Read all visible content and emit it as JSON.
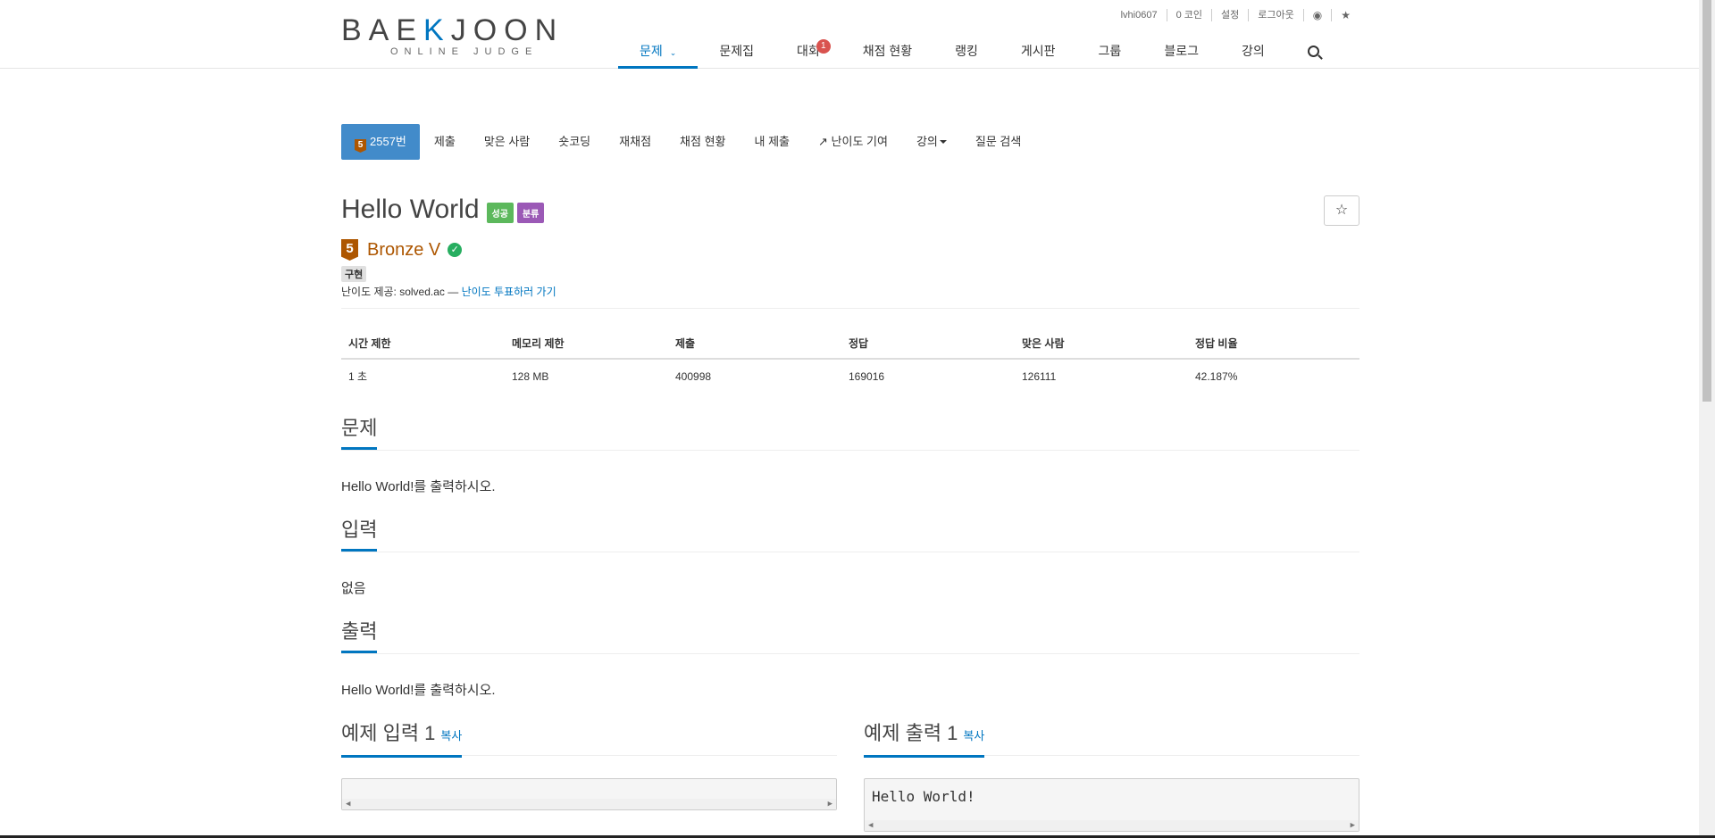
{
  "logo": {
    "main_a": "BAE",
    "main_accent": "K",
    "main_b": "JOON",
    "sub": "ONLINE JUDGE"
  },
  "topbar": {
    "user": "lvhi0607",
    "coins": "0 코인",
    "settings": "설정",
    "logout": "로그아웃"
  },
  "nav": {
    "problems": "문제",
    "workbook": "문제집",
    "contest": "대회",
    "contest_badge": "1",
    "status": "채점 현황",
    "ranking": "랭킹",
    "board": "게시판",
    "group": "그룹",
    "blog": "블로그",
    "lecture": "강의"
  },
  "pmenu": {
    "number": "2557번",
    "tier_digit": "5",
    "submit": "제출",
    "solved_users": "맞은 사람",
    "shortcoding": "숏코딩",
    "rejudge": "재채점",
    "status": "채점 현황",
    "my_submissions": "내 제출",
    "difficulty_contrib": "난이도 기여",
    "lecture": "강의",
    "question_search": "질문 검색"
  },
  "problem": {
    "title": "Hello World",
    "label_success": "성공",
    "label_category": "분류",
    "tier_digit": "5",
    "tier_name": "Bronze V",
    "tag": "구현",
    "credit_prefix": "난이도 제공: solved.ac — ",
    "credit_link": "난이도 투표하러 가기"
  },
  "info_table": {
    "headers": [
      "시간 제한",
      "메모리 제한",
      "제출",
      "정답",
      "맞은 사람",
      "정답 비율"
    ],
    "values": [
      "1 초",
      "128 MB",
      "400998",
      "169016",
      "126111",
      "42.187%"
    ]
  },
  "sections": {
    "problem_title": "문제",
    "problem_text": "Hello World!를 출력하시오.",
    "input_title": "입력",
    "input_text": "없음",
    "output_title": "출력",
    "output_text": "Hello World!를 출력하시오.",
    "sample_input_title": "예제 입력 1",
    "sample_output_title": "예제 출력 1",
    "copy": "복사",
    "sample_input": "",
    "sample_output": "Hello World!"
  }
}
